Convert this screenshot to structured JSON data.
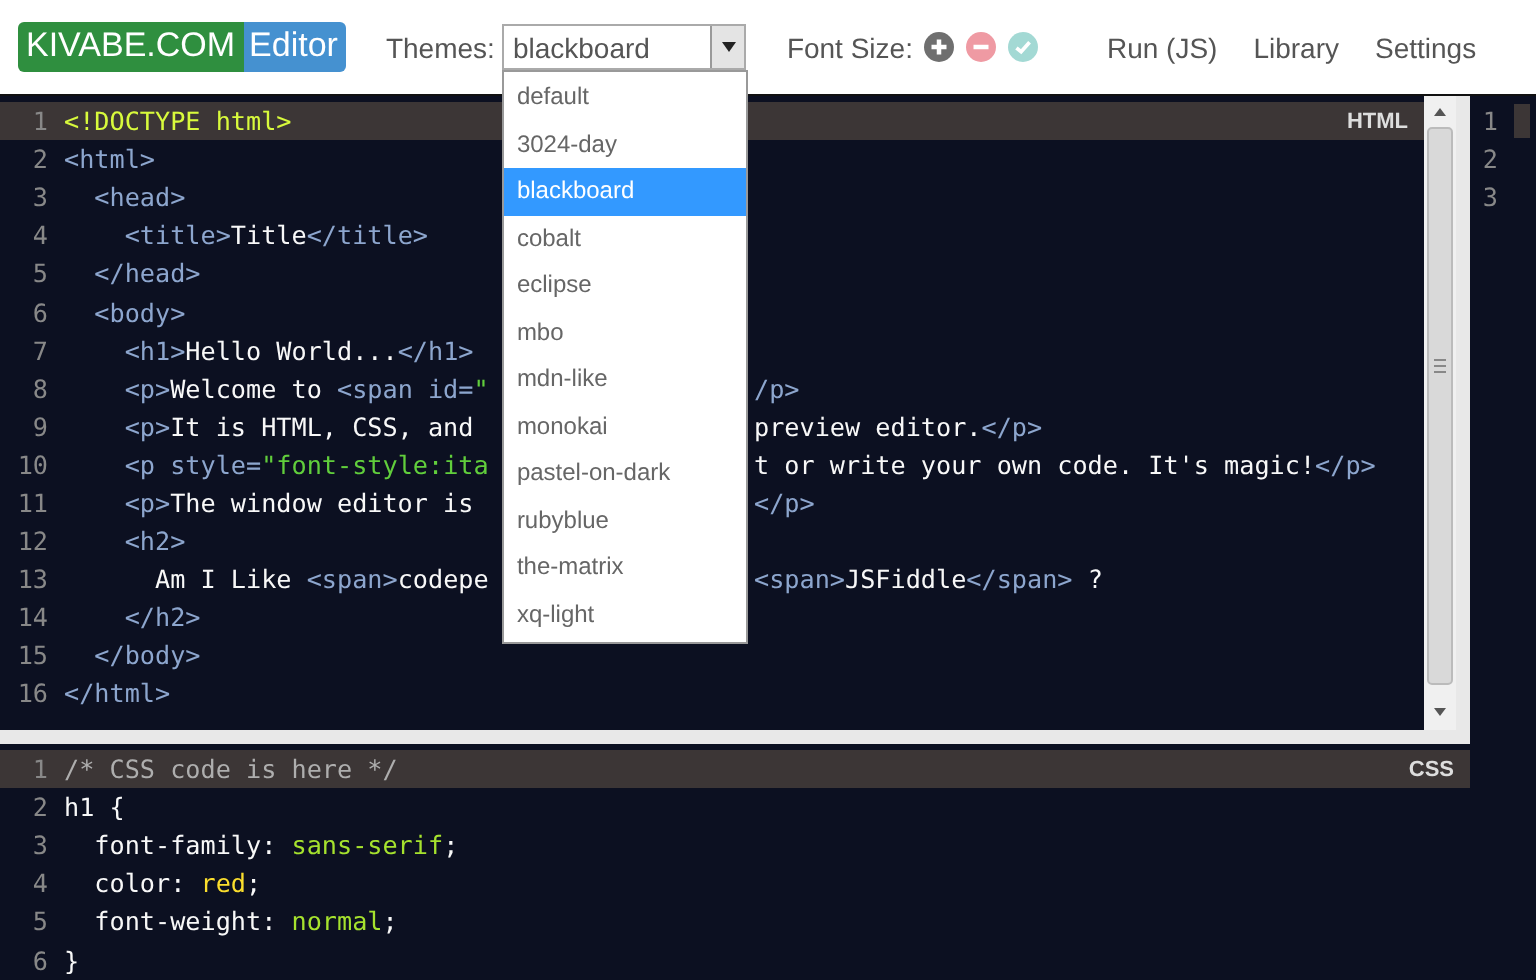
{
  "header": {
    "logo": {
      "brand": "KIVABE.COM",
      "product": "Editor"
    },
    "themes_label": "Themes:",
    "theme_select": {
      "value": "blackboard",
      "expanded": true
    },
    "font_size_label": "Font Size:",
    "nav": [
      "Run (JS)",
      "Library",
      "Settings"
    ]
  },
  "theme_options": [
    {
      "label": "default",
      "selected": false
    },
    {
      "label": "3024-day",
      "selected": false
    },
    {
      "label": "blackboard",
      "selected": true
    },
    {
      "label": "cobalt",
      "selected": false
    },
    {
      "label": "eclipse",
      "selected": false
    },
    {
      "label": "mbo",
      "selected": false
    },
    {
      "label": "mdn-like",
      "selected": false
    },
    {
      "label": "monokai",
      "selected": false
    },
    {
      "label": "pastel-on-dark",
      "selected": false
    },
    {
      "label": "rubyblue",
      "selected": false
    },
    {
      "label": "the-matrix",
      "selected": false
    },
    {
      "label": "xq-light",
      "selected": false
    }
  ],
  "html_editor": {
    "mode": "HTML",
    "lines": [
      {
        "n": "1",
        "active": true,
        "left": [
          {
            "t": "<!DOCTYPE html>",
            "kind": "meta"
          }
        ]
      },
      {
        "n": "2",
        "active": false,
        "left": [
          {
            "t": "<html>",
            "kind": "tag"
          }
        ]
      },
      {
        "n": "3",
        "active": false,
        "left": [
          {
            "t": "  <head>",
            "kind": "tag"
          }
        ]
      },
      {
        "n": "4",
        "active": false,
        "left": [
          {
            "t": "    <title>",
            "kind": "tag"
          },
          {
            "t": "Title",
            "kind": "text"
          },
          {
            "t": "</title>",
            "kind": "tag"
          }
        ]
      },
      {
        "n": "5",
        "active": false,
        "left": [
          {
            "t": "  </head>",
            "kind": "tag"
          }
        ]
      },
      {
        "n": "6",
        "active": false,
        "left": [
          {
            "t": "  <body>",
            "kind": "tag"
          }
        ]
      },
      {
        "n": "7",
        "active": false,
        "left": [
          {
            "t": "    <h1>",
            "kind": "tag"
          },
          {
            "t": "Hello World...",
            "kind": "text"
          },
          {
            "t": "</h1>",
            "kind": "tag"
          }
        ]
      },
      {
        "n": "8",
        "active": false,
        "left": [
          {
            "t": "    <p>",
            "kind": "tag"
          },
          {
            "t": "Welcome to ",
            "kind": "text"
          },
          {
            "t": "<span id=",
            "kind": "tag"
          },
          {
            "t": "\"",
            "kind": "string"
          }
        ],
        "right": [
          {
            "t": "/p>",
            "kind": "tag"
          }
        ]
      },
      {
        "n": "9",
        "active": false,
        "left": [
          {
            "t": "    <p>",
            "kind": "tag"
          },
          {
            "t": "It is HTML, CSS, and",
            "kind": "text"
          }
        ],
        "right": [
          {
            "t": "preview editor.",
            "kind": "text"
          },
          {
            "t": "</p>",
            "kind": "tag"
          }
        ]
      },
      {
        "n": "10",
        "active": false,
        "left": [
          {
            "t": "    <p style=",
            "kind": "tag"
          },
          {
            "t": "\"font-style:ita",
            "kind": "string"
          }
        ],
        "right": [
          {
            "t": "t or write your own code. It's magic!",
            "kind": "text"
          },
          {
            "t": "</p>",
            "kind": "tag"
          }
        ]
      },
      {
        "n": "11",
        "active": false,
        "left": [
          {
            "t": "    <p>",
            "kind": "tag"
          },
          {
            "t": "The window editor is",
            "kind": "text"
          }
        ],
        "right": [
          {
            "t": "</p>",
            "kind": "tag"
          }
        ]
      },
      {
        "n": "12",
        "active": false,
        "left": [
          {
            "t": "    <h2>",
            "kind": "tag"
          }
        ]
      },
      {
        "n": "13",
        "active": false,
        "left": [
          {
            "t": "      Am I Like ",
            "kind": "text"
          },
          {
            "t": "<span>",
            "kind": "tag"
          },
          {
            "t": "codepe",
            "kind": "text"
          }
        ],
        "right": [
          {
            "t": "<span>",
            "kind": "tag"
          },
          {
            "t": "JSFiddle",
            "kind": "text"
          },
          {
            "t": "</span>",
            "kind": "tag"
          },
          {
            "t": " ?",
            "kind": "text"
          }
        ]
      },
      {
        "n": "14",
        "active": false,
        "left": [
          {
            "t": "    </h2>",
            "kind": "tag"
          }
        ]
      },
      {
        "n": "15",
        "active": false,
        "left": [
          {
            "t": "  </body>",
            "kind": "tag"
          }
        ]
      },
      {
        "n": "16",
        "active": false,
        "left": [
          {
            "t": "</html>",
            "kind": "tag"
          }
        ]
      }
    ]
  },
  "side_editor": {
    "lines": [
      {
        "n": "1",
        "active": true
      },
      {
        "n": "2",
        "active": false
      },
      {
        "n": "3",
        "active": false
      }
    ]
  },
  "css_editor": {
    "mode": "CSS",
    "lines": [
      {
        "n": "1",
        "active": true,
        "left": [
          {
            "t": "/* CSS code is here */",
            "kind": "comment"
          }
        ]
      },
      {
        "n": "2",
        "active": false,
        "left": [
          {
            "t": "h1 {",
            "kind": "text"
          }
        ]
      },
      {
        "n": "3",
        "active": false,
        "left": [
          {
            "t": "  font-family: ",
            "kind": "text"
          },
          {
            "t": "sans-serif",
            "kind": "value"
          },
          {
            "t": ";",
            "kind": "text"
          }
        ]
      },
      {
        "n": "4",
        "active": false,
        "left": [
          {
            "t": "  color: ",
            "kind": "text"
          },
          {
            "t": "red",
            "kind": "keyword"
          },
          {
            "t": ";",
            "kind": "text"
          }
        ]
      },
      {
        "n": "5",
        "active": false,
        "left": [
          {
            "t": "  font-weight: ",
            "kind": "text"
          },
          {
            "t": "normal",
            "kind": "value"
          },
          {
            "t": ";",
            "kind": "text"
          }
        ]
      },
      {
        "n": "6",
        "active": false,
        "left": [
          {
            "t": "}",
            "kind": "text"
          }
        ]
      }
    ]
  }
}
